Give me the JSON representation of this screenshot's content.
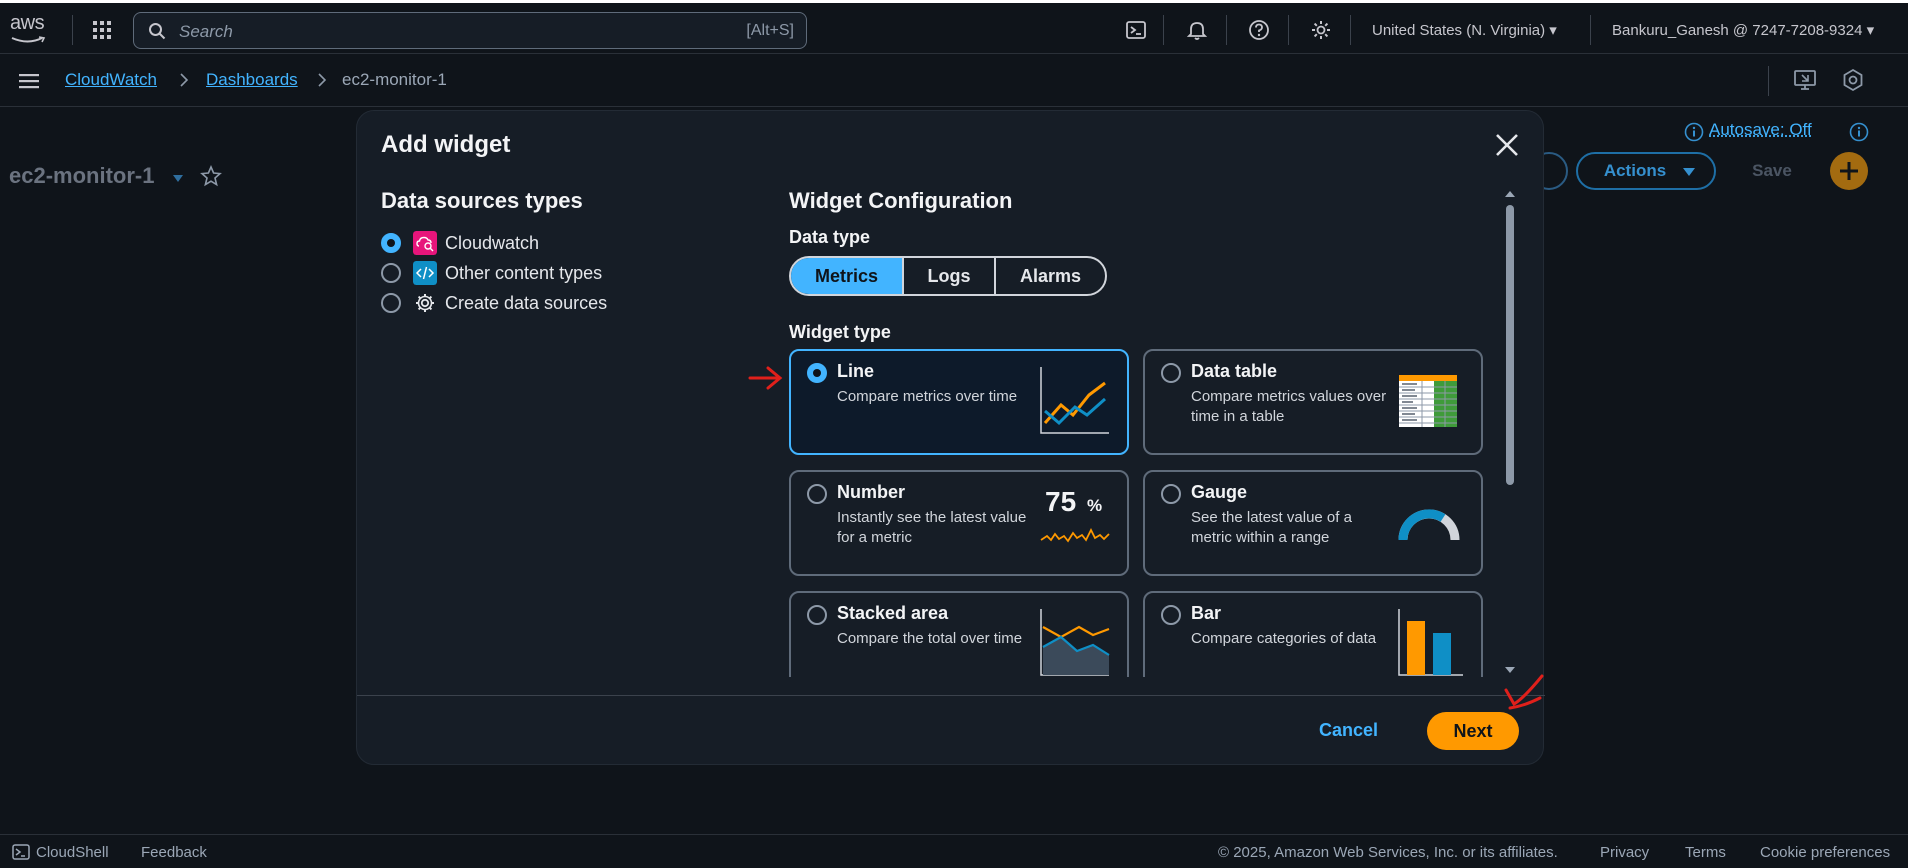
{
  "topnav": {
    "logo_text": "aws",
    "search_placeholder": "Search",
    "search_shortcut": "[Alt+S]",
    "region": "United States (N. Virginia) ▾",
    "account": "Bankuru_Ganesh @ 7247-7208-9324 ▾",
    "icons": [
      "apps-grid-icon",
      "cloudshell-icon",
      "bell-icon",
      "help-icon",
      "gear-icon"
    ]
  },
  "breadcrumb": {
    "items": [
      {
        "label": "CloudWatch"
      },
      {
        "label": "Dashboards"
      },
      {
        "label": "ec2-monitor-1"
      }
    ]
  },
  "page": {
    "title": "ec2-monitor-1",
    "autosave": "Autosave: Off",
    "actions_label": "Actions",
    "save_label": "Save"
  },
  "modal": {
    "title": "Add widget",
    "left": {
      "title": "Data sources types",
      "options": [
        {
          "label": "Cloudwatch",
          "selected": true,
          "icon": "cloudwatch-icon"
        },
        {
          "label": "Other content types",
          "selected": false,
          "icon": "code-icon"
        },
        {
          "label": "Create data sources",
          "selected": false,
          "icon": "gear-icon"
        }
      ]
    },
    "right": {
      "title": "Widget Configuration",
      "data_type_label": "Data type",
      "data_types": [
        "Metrics",
        "Logs",
        "Alarms"
      ],
      "data_type_selected": "Metrics",
      "widget_type_label": "Widget type",
      "widgets": [
        {
          "title": "Line",
          "desc": "Compare metrics over time",
          "selected": true
        },
        {
          "title": "Data table",
          "desc": "Compare metrics values over time in a table",
          "selected": false
        },
        {
          "title": "Number",
          "desc": "Instantly see the latest value for a metric",
          "selected": false,
          "value_text": "75",
          "unit_text": "%"
        },
        {
          "title": "Gauge",
          "desc": "See the latest value of a metric within a range",
          "selected": false
        },
        {
          "title": "Stacked area",
          "desc": "Compare the total over time",
          "selected": false
        },
        {
          "title": "Bar",
          "desc": "Compare categories of data",
          "selected": false
        }
      ]
    },
    "cancel_label": "Cancel",
    "next_label": "Next"
  },
  "bottombar": {
    "cloudshell": "CloudShell",
    "feedback": "Feedback",
    "copyright": "© 2025, Amazon Web Services, Inc. or its affiliates.",
    "privacy": "Privacy",
    "terms": "Terms",
    "cookie": "Cookie preferences"
  },
  "colors": {
    "accent": "#42b4ff",
    "primary_button": "#ff9900",
    "background": "#0f141a",
    "modal_bg": "#161d26",
    "annotation": "#e0201b"
  }
}
